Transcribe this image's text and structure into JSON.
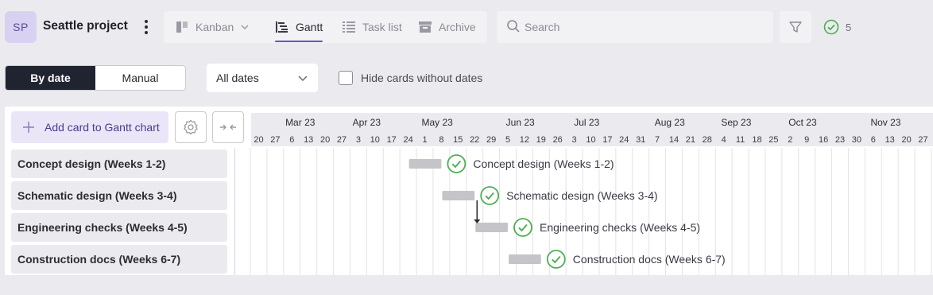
{
  "project": {
    "initials": "SP",
    "title": "Seattle project"
  },
  "views": {
    "tabs": [
      {
        "label": "Kanban",
        "icon": "kanban-icon",
        "active": false
      },
      {
        "label": "Gantt",
        "icon": "gantt-icon",
        "active": true
      },
      {
        "label": "Task list",
        "icon": "list-icon",
        "active": false
      },
      {
        "label": "Archive",
        "icon": "archive-icon",
        "active": false
      }
    ]
  },
  "search": {
    "placeholder": "Search",
    "value": ""
  },
  "done_counter": {
    "count": "5"
  },
  "sort_mode": {
    "by_date": "By date",
    "manual": "Manual",
    "selected": "By date"
  },
  "date_filter": {
    "selected": "All dates"
  },
  "hide_cards": {
    "label": "Hide cards without dates",
    "checked": false
  },
  "toolbar": {
    "add_card": "Add card to Gantt chart"
  },
  "cards": [
    {
      "label": "Concept design (Weeks 1-2)"
    },
    {
      "label": "Schematic design (Weeks 3-4)"
    },
    {
      "label": "Engineering checks (Weeks 4-5)"
    },
    {
      "label": "Construction docs (Weeks 6-7)"
    }
  ],
  "timeline": {
    "months": [
      "Mar 23",
      "Apr 23",
      "May 23",
      "Jun 23",
      "Jul 23",
      "Aug 23",
      "Sep 23",
      "Oct 23",
      "Nov 23"
    ],
    "ticks": [
      "20",
      "27",
      "6",
      "13",
      "20",
      "27",
      "3",
      "10",
      "17",
      "24",
      "1",
      "8",
      "15",
      "22",
      "29",
      "5",
      "12",
      "19",
      "26",
      "3",
      "10",
      "17",
      "24",
      "31",
      "7",
      "14",
      "21",
      "28",
      "4",
      "11",
      "18",
      "25",
      "2",
      "9",
      "16",
      "23",
      "30",
      "6",
      "13",
      "20",
      "27"
    ]
  },
  "colors": {
    "accent": "#6a52c4",
    "done_green": "#4caf50",
    "bar_gray": "#c4c4c9",
    "active_seg": "#1f2430"
  }
}
